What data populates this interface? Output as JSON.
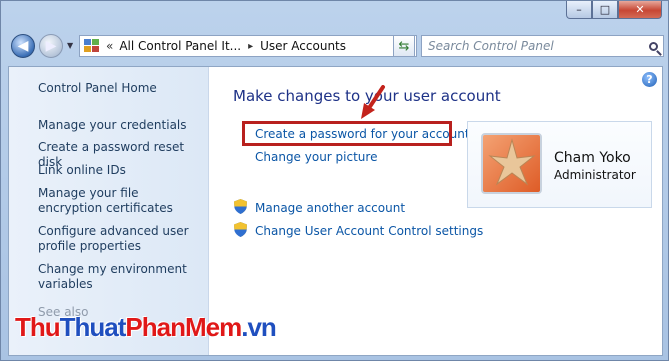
{
  "window": {
    "caption_buttons": {
      "minimize": "–",
      "maximize": "□",
      "close": "✕"
    }
  },
  "navigation": {
    "address_chevron": "«",
    "breadcrumb": [
      "All Control Panel It...",
      "User Accounts"
    ],
    "breadcrumb_separator": "▸",
    "search_placeholder": "Search Control Panel"
  },
  "sidebar": {
    "home": "Control Panel Home",
    "tasks": [
      "Manage your credentials",
      "Create a password reset disk",
      "Link online IDs",
      "Manage your file encryption certificates",
      "Configure advanced user profile properties",
      "Change my environment variables"
    ],
    "see_also": "See also"
  },
  "main": {
    "title": "Make changes to your user account",
    "links": [
      "Create a password for your account",
      "Change your picture"
    ],
    "admin_links": [
      "Manage another account",
      "Change User Account Control settings"
    ],
    "help_icon_label": "?"
  },
  "user": {
    "name": "Cham Yoko",
    "role": "Administrator",
    "picture": "starfish"
  },
  "watermark": {
    "part1": "Thu",
    "part2": "Thuat",
    "part3": "PhanMem",
    "part4": ".vn"
  },
  "colors": {
    "link": "#0b56a6",
    "title": "#1e3287",
    "highlight_border": "#b8201e",
    "watermark_red": "#e01818",
    "watermark_blue": "#1f4fbf"
  }
}
